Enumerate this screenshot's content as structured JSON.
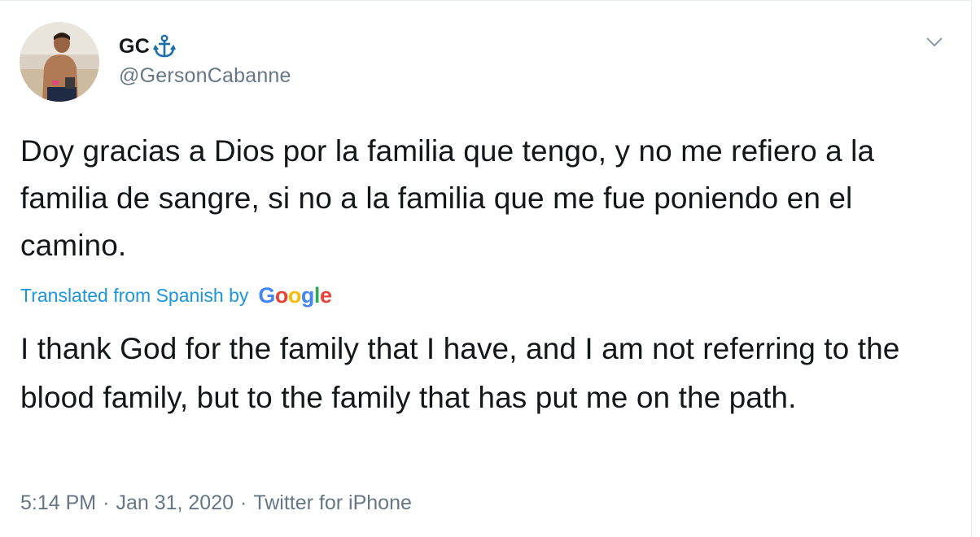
{
  "author": {
    "display_name": "GC",
    "name_emoji": "anchor-icon",
    "handle": "@GersonCabanne",
    "avatar": "profile-photo"
  },
  "tweet": {
    "original_text": "Doy gracias a Dios por la familia que tengo, y no me refiero a la familia de sangre, si no a la familia que me fue poniendo en el camino.",
    "translation_label": "Translated from Spanish by",
    "translation_provider": {
      "g1": "G",
      "o1": "o",
      "o2": "o",
      "g2": "g",
      "l": "l",
      "e": "e"
    },
    "translated_text": "I thank God for the family that I have, and I am not referring to the blood family, but to the family that has put me on the path."
  },
  "meta": {
    "time": "5:14 PM",
    "separator": "·",
    "date": "Jan 31, 2020",
    "source": "Twitter for iPhone"
  },
  "icons": {
    "more_menu": "chevron-down-icon"
  },
  "colors": {
    "link_blue": "#1b95e0",
    "secondary_text": "#657786",
    "primary_text": "#14171a"
  }
}
